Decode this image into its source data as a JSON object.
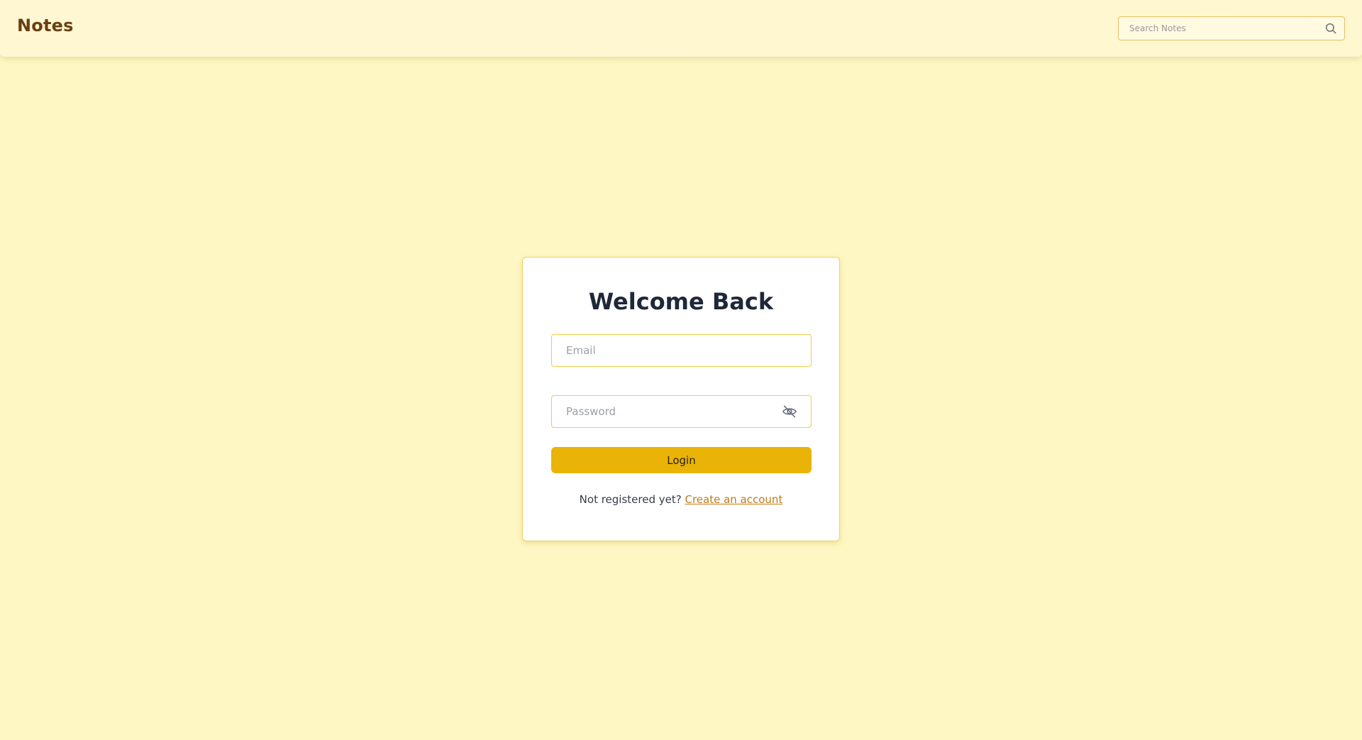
{
  "header": {
    "brand": "Notes",
    "search": {
      "placeholder": "Search Notes",
      "value": "",
      "icon": "search-icon"
    }
  },
  "login": {
    "title": "Welcome Back",
    "email": {
      "placeholder": "Email",
      "value": ""
    },
    "password": {
      "placeholder": "Password",
      "value": "",
      "toggle_icon": "eye-off-icon"
    },
    "submit_label": "Login",
    "register_prompt": "Not registered yet?",
    "register_link": "Create an account"
  },
  "colors": {
    "background": "#fef7c3",
    "brand_text": "#6b3f12",
    "accent": "#eab308",
    "input_border": "#f2cc46",
    "link": "#c07a14",
    "title": "#1e2838"
  }
}
